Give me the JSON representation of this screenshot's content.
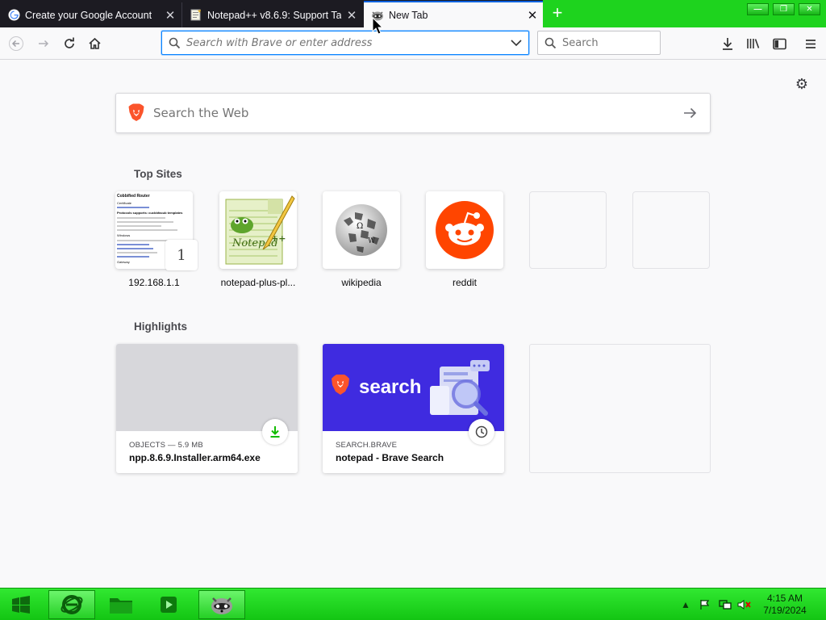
{
  "tabs": [
    {
      "title": "Create your Google Account",
      "icon": "google-icon"
    },
    {
      "title": "Notepad++ v8.6.9: Support Tar",
      "icon": "notepad-icon"
    },
    {
      "title": "New Tab",
      "icon": "raccoon-icon"
    }
  ],
  "navbar": {
    "url_placeholder": "Search with Brave or enter address",
    "search_placeholder": "Search"
  },
  "content": {
    "web_search_placeholder": "Search the Web",
    "top_sites_title": "Top Sites",
    "highlights_title": "Highlights",
    "top_sites": [
      {
        "label": "192.168.1.1",
        "pin_number": "1"
      },
      {
        "label": "notepad-plus-pl..."
      },
      {
        "label": "wikipedia"
      },
      {
        "label": "reddit"
      },
      {
        "label": ""
      },
      {
        "label": ""
      }
    ],
    "highlights": [
      {
        "context": "OBJECTS — 5.9 MB",
        "title": "npp.8.6.9.Installer.arm64.exe",
        "badge": "download-icon"
      },
      {
        "context": "SEARCH.BRAVE",
        "title": "notepad - Brave Search",
        "badge": "clock-icon",
        "thumb_text": "search"
      }
    ],
    "router_thumb_lines": [
      "Cobbified Router",
      "Certificate",
      "Protocols supports: cucbbfacub templates",
      "Windows",
      "Gateway"
    ]
  },
  "taskbar": {
    "time": "4:15 AM",
    "date": "7/19/2024"
  },
  "colors": {
    "accent_green": "#1ed31e",
    "tab_dark": "#1c1b22",
    "focus_blue": "#0a84ff",
    "brave_orange": "#fb542b",
    "reddit_orange": "#ff4500",
    "brave_search_bg": "#3f2be0"
  }
}
